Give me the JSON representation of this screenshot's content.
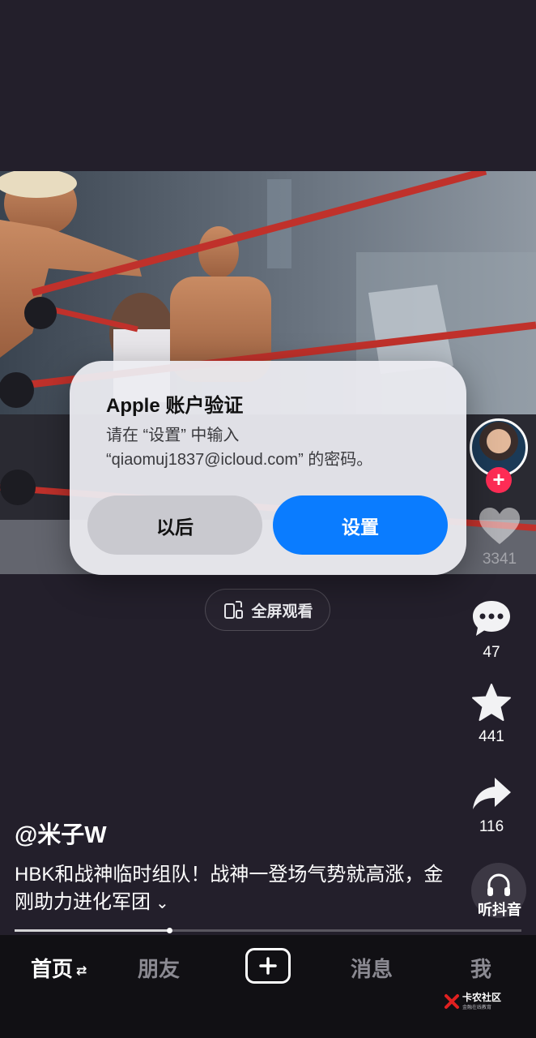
{
  "video": {
    "fullscreen_label": "全屏观看"
  },
  "sidebar": {
    "likes": "3341",
    "comments": "47",
    "favorites": "441",
    "shares": "116",
    "listen_label": "听抖音"
  },
  "post": {
    "author": "@米子W",
    "caption": "HBK和战神临时组队！战神一登场气势就高涨，金刚助力进化军团",
    "progress": 0.305
  },
  "tabbar": {
    "home": "首页",
    "friends": "朋友",
    "messages": "消息",
    "me": "我"
  },
  "dialog": {
    "title": "Apple 账户验证",
    "body_line1": "请在 “设置” 中输入",
    "body_line2": "“qiaomuj1837@icloud.com” 的密码。",
    "later_label": "以后",
    "settings_label": "设置"
  },
  "watermark": {
    "title": "卡农社区",
    "subtitle": "金融在线教育"
  },
  "colors": {
    "accent_blue": "#0a7cff",
    "follow_red": "#fe2c55",
    "background": "#231f2b"
  }
}
